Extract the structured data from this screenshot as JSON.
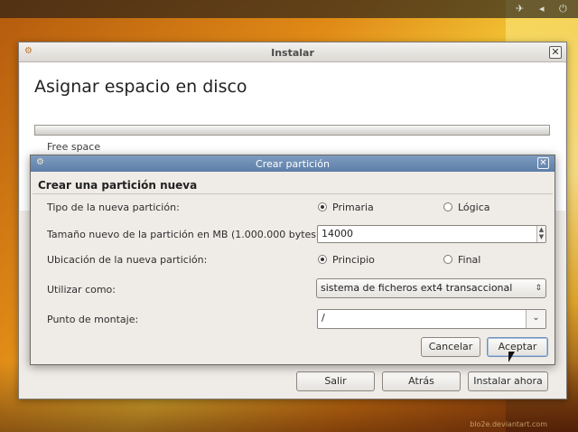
{
  "main_window": {
    "title": "Instalar",
    "heading": "Asignar espacio en disco",
    "free_space_label": "Free space",
    "buttons": {
      "quit": "Salir",
      "back": "Atrás",
      "install": "Instalar ahora"
    }
  },
  "dialog": {
    "title": "Crear partición",
    "heading": "Crear una partición nueva",
    "type_label": "Tipo de la nueva partición:",
    "type_primary": "Primaria",
    "type_logical": "Lógica",
    "type_selected": "Primaria",
    "size_label": "Tamaño nuevo de la partición en MB (1.000.000 bytes):",
    "size_value": "14000",
    "location_label": "Ubicación de la nueva partición:",
    "location_start": "Principio",
    "location_end": "Final",
    "location_selected": "Principio",
    "use_as_label": "Utilizar como:",
    "use_as_value": "sistema de ficheros ext4 transaccional",
    "mount_label": "Punto de montaje:",
    "mount_value": "/",
    "cancel_button": "Cancelar",
    "ok_button": "Aceptar"
  },
  "watermark": "blo2e.deviantart.com",
  "icons": [
    "installer-icon",
    "close-icon",
    "chevron-down-icon",
    "spinner-icon",
    "pointer-icon"
  ]
}
